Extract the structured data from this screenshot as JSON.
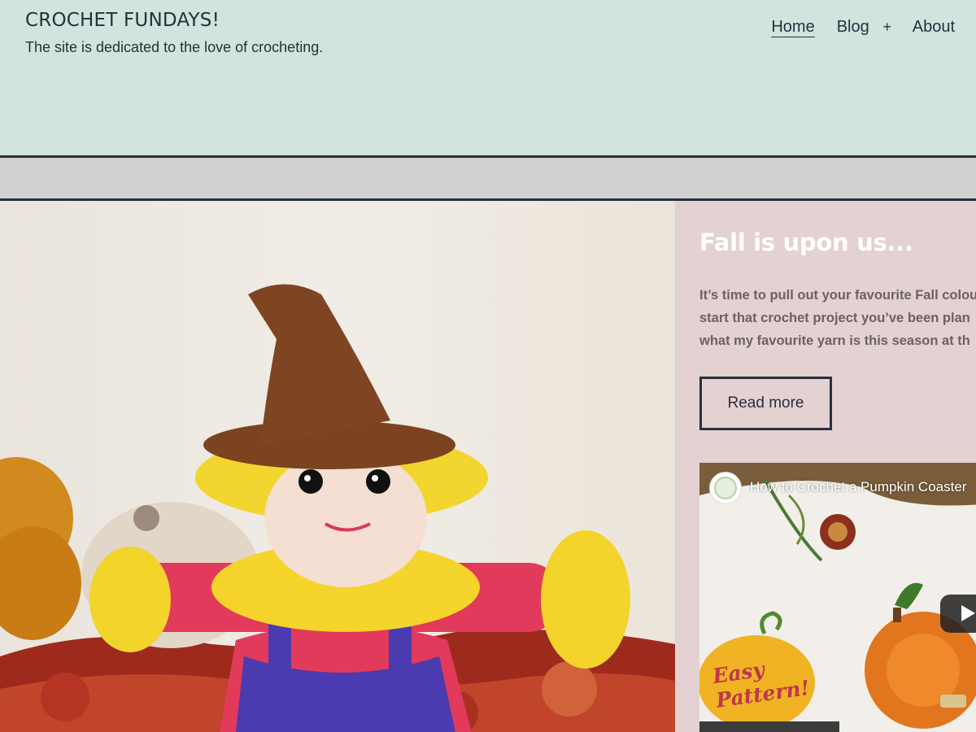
{
  "site": {
    "title": "CROCHET FUNDAYS!",
    "tagline": "The site is dedicated to the love of crocheting."
  },
  "nav": {
    "items": [
      {
        "label": "Home",
        "active": true
      },
      {
        "label": "Blog",
        "active": false
      },
      {
        "label": "+",
        "active": false
      },
      {
        "label": "About",
        "active": false
      }
    ]
  },
  "hero": {
    "image_icon": "scarecrow-crochet-photo"
  },
  "post": {
    "title": "Fall is upon us...",
    "excerpt_lines": [
      "It’s time to pull out your favourite Fall colou",
      "start that crochet project you’ve been plan",
      "what my favourite yarn is this season at th"
    ],
    "read_more": "Read more"
  },
  "video": {
    "title": "How to Crochet a Pumpkin Coaster",
    "badge_line1": "Easy",
    "badge_line2": "Pattern!",
    "play_icon": "play-icon"
  },
  "colors": {
    "header_bg": "#d1e4dd",
    "band_bg": "#d1d1d1",
    "panel_bg": "#e4d1d1",
    "text_dark": "#28303d"
  }
}
